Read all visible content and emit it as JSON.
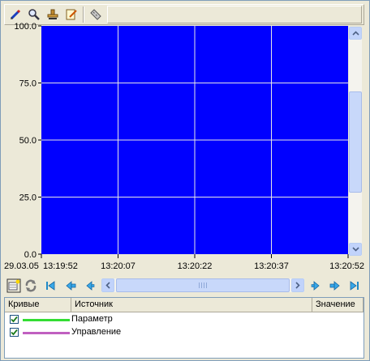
{
  "toolbar": {
    "icons": [
      "pencil-icon",
      "zoom-icon",
      "stamp-icon",
      "edit-note-icon",
      "ruler-icon"
    ]
  },
  "colors": {
    "plot_bg": "#0000ff",
    "grid": "#e6e6e6",
    "series1": "#33dd33",
    "series2": "#c060c0"
  },
  "chart_data": {
    "type": "line",
    "y_ticks": [
      "100.0",
      "75.0",
      "50.0",
      "25.0",
      "0.0"
    ],
    "ylim": [
      0,
      100
    ],
    "x_date": "29.03.05",
    "x_ticks": [
      "13:19:52",
      "13:20:07",
      "13:20:22",
      "13:20:37",
      "13:20:52"
    ],
    "grid": true,
    "series": [
      {
        "name": "Параметр",
        "values": []
      },
      {
        "name": "Управление",
        "values": []
      }
    ]
  },
  "table": {
    "headers": {
      "curves": "Кривые",
      "source": "Источник",
      "value": "Значение"
    },
    "rows": [
      {
        "checked": true,
        "color": "#33dd33",
        "label": "Параметр",
        "value": ""
      },
      {
        "checked": true,
        "color": "#c060c0",
        "label": "Управление",
        "value": ""
      }
    ]
  }
}
